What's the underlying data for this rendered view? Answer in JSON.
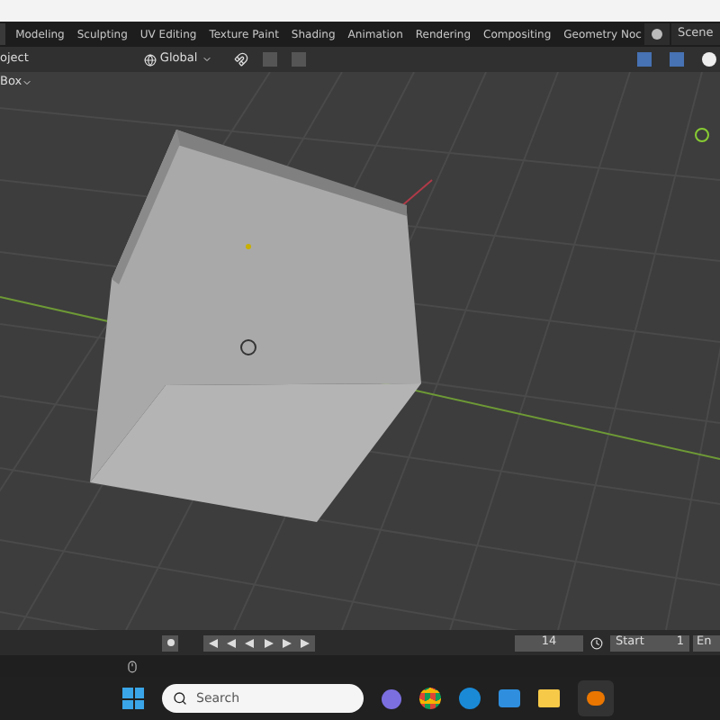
{
  "workspace_tabs": [
    {
      "label": "Modeling"
    },
    {
      "label": "Sculpting"
    },
    {
      "label": "UV Editing"
    },
    {
      "label": "Texture Paint"
    },
    {
      "label": "Shading"
    },
    {
      "label": "Animation"
    },
    {
      "label": "Rendering"
    },
    {
      "label": "Compositing"
    },
    {
      "label": "Geometry Noc"
    }
  ],
  "scene": "Scene",
  "header": {
    "mode": "oject",
    "orientation": "Global",
    "object_menu": "Box"
  },
  "timeline": {
    "current_frame": "14",
    "start_label": "Start",
    "start_value": "1",
    "end_label": "En"
  },
  "taskbar": {
    "search_placeholder": "Search"
  }
}
